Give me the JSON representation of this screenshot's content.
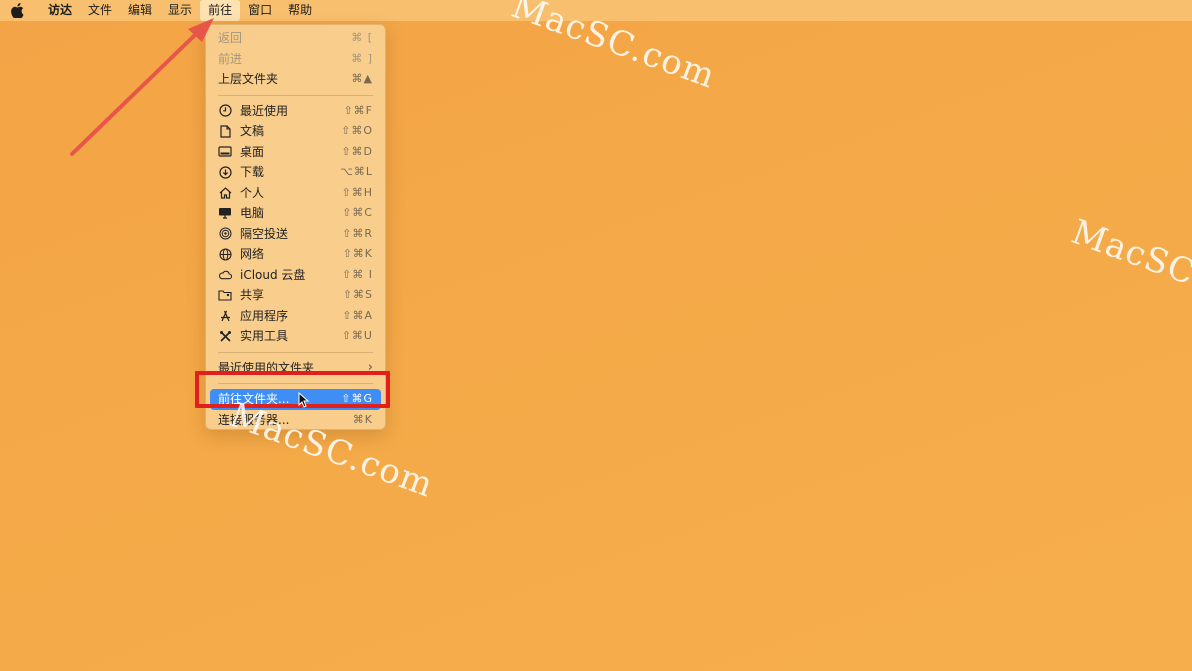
{
  "menubar": {
    "app_name": "访达",
    "items": [
      "文件",
      "编辑",
      "显示",
      "前往",
      "窗口",
      "帮助"
    ]
  },
  "go_menu": {
    "back": {
      "label": "返回",
      "shortcut": "⌘ ["
    },
    "forward": {
      "label": "前进",
      "shortcut": "⌘ ]"
    },
    "enclosing_folder": {
      "label": "上层文件夹",
      "shortcut": "⌘▲"
    },
    "places": [
      {
        "label": "最近使用",
        "shortcut": "⇧⌘F",
        "icon": "clock-icon"
      },
      {
        "label": "文稿",
        "shortcut": "⇧⌘O",
        "icon": "document-icon"
      },
      {
        "label": "桌面",
        "shortcut": "⇧⌘D",
        "icon": "desktop-icon"
      },
      {
        "label": "下载",
        "shortcut": "⌥⌘L",
        "icon": "download-icon"
      },
      {
        "label": "个人",
        "shortcut": "⇧⌘H",
        "icon": "home-icon"
      },
      {
        "label": "电脑",
        "shortcut": "⇧⌘C",
        "icon": "computer-icon"
      },
      {
        "label": "隔空投送",
        "shortcut": "⇧⌘R",
        "icon": "airdrop-icon"
      },
      {
        "label": "网络",
        "shortcut": "⇧⌘K",
        "icon": "globe-icon"
      },
      {
        "label": "iCloud 云盘",
        "shortcut": "⇧⌘ I",
        "icon": "cloud-icon"
      },
      {
        "label": "共享",
        "shortcut": "⇧⌘S",
        "icon": "shared-folder-icon"
      },
      {
        "label": "应用程序",
        "shortcut": "⇧⌘A",
        "icon": "applications-icon"
      },
      {
        "label": "实用工具",
        "shortcut": "⇧⌘U",
        "icon": "utilities-icon"
      }
    ],
    "recent_folders": {
      "label": "最近使用的文件夹",
      "chevron": "›"
    },
    "go_to_folder": {
      "label": "前往文件夹...",
      "shortcut": "⇧⌘G"
    },
    "connect_server": {
      "label": "连接服务器...",
      "shortcut": "⌘K"
    }
  },
  "watermarks": [
    "MacSC.com",
    "MacSC.co",
    "MacSC.com"
  ],
  "colors": {
    "highlight": "#3e8ef5",
    "annotation_red": "#e0201c"
  }
}
